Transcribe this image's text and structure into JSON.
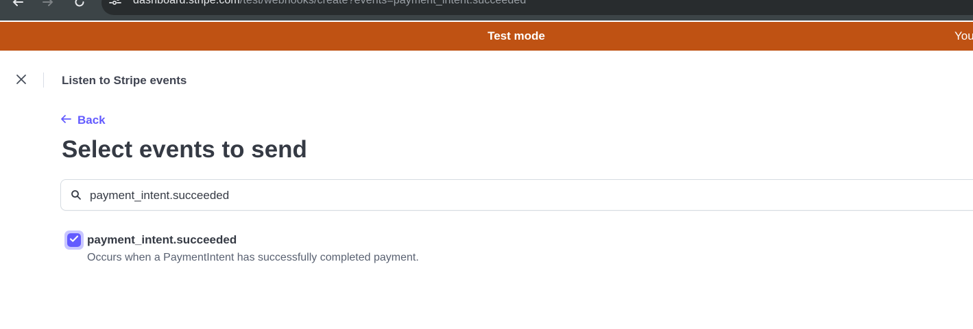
{
  "browser": {
    "url_host": "dashboard.stripe.com",
    "url_path": "/test/webhooks/create?events=payment_intent.succeeded",
    "icons": [
      "back-arrow-icon",
      "forward-arrow-icon",
      "reload-icon",
      "site-info-icon"
    ]
  },
  "banner": {
    "label": "Test mode",
    "right_text": "You",
    "color": "#bf5213"
  },
  "header": {
    "title": "Listen to Stripe events",
    "close_icon": "close-icon"
  },
  "back_link": {
    "label": "Back",
    "icon": "arrow-left-icon"
  },
  "page_title": "Select events to send",
  "search": {
    "value": "payment_intent.succeeded",
    "icon": "search-icon"
  },
  "events": [
    {
      "name": "payment_intent.succeeded",
      "description": "Occurs when a PaymentIntent has successfully completed payment.",
      "checked": true
    }
  ],
  "colors": {
    "accent": "#635bff",
    "heading": "#353a44",
    "secondary_text": "#596171"
  }
}
